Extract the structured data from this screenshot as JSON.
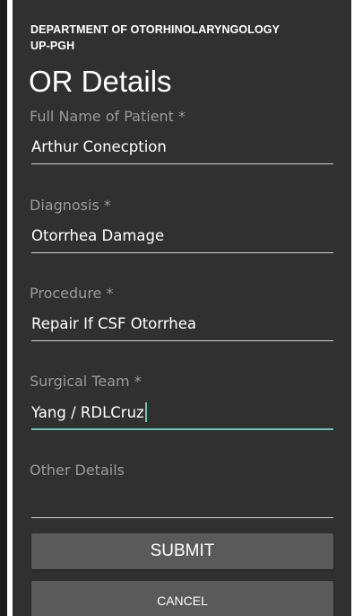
{
  "header": {
    "department_line1": "DEPARTMENT OF OTORHINOLARYNGOLOGY",
    "department_line2": "UP-PGH",
    "title": "OR Details"
  },
  "form": {
    "patient": {
      "label": "Full Name of Patient *",
      "value": "Arthur Conecption"
    },
    "diagnosis": {
      "label": "Diagnosis *",
      "value": "Otorrhea Damage"
    },
    "procedure": {
      "label": "Procedure *",
      "value": "Repair If CSF Otorrhea"
    },
    "surgical_team": {
      "label": "Surgical Team *",
      "value": "Yang / RDLCruz"
    },
    "other_details": {
      "label": "Other Details",
      "value": ""
    }
  },
  "buttons": {
    "submit": "SUBMIT",
    "cancel": "CANCEL"
  },
  "colors": {
    "background": "#303030",
    "accent": "#61c9b7",
    "label": "#9a9a9a",
    "button": "#5a5a5a"
  }
}
